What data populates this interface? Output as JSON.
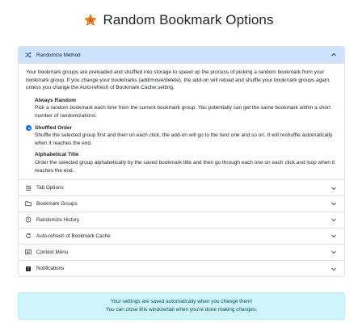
{
  "header": {
    "title": "Random Bookmark Options",
    "logo_icon": "star-icon"
  },
  "accordion": {
    "randomize_method": {
      "label": "Randomize Method",
      "icon": "shuffle-icon",
      "expanded": true,
      "intro": "Your bookmark groups are preloaded and shuffled into storage to speed up the process of picking a random bookmark from your bookmark group. If you change your bookmarks (add/move/delete), the add-on will reload and shuffle your bookmark groups again, unless you change the Auto-refresh of Bookmark Cache setting.",
      "options": [
        {
          "title": "Always Random",
          "desc": "Pick a random bookmark each time from the current bookmark group. You potentially can get the same bookmark within a short number of randomizations.",
          "selected": false
        },
        {
          "title": "Shuffled Order",
          "desc": "Shuffle the selected group first and then on each click, the add-on will go to the next one and so on. It will reshuffle automatically when it reaches the end.",
          "selected": true
        },
        {
          "title": "Alphabetical Title",
          "desc": "Order the selected group alphabetically by the saved bookmark title and then go through each one on each click and loop when it reaches the end.",
          "selected": false
        }
      ]
    },
    "sections": [
      {
        "label": "Tab Options",
        "icon": "tab-icon"
      },
      {
        "label": "Bookmark Groups",
        "icon": "folder-icon"
      },
      {
        "label": "Randomize History",
        "icon": "history-icon"
      },
      {
        "label": "Auto-refresh of Bookmark Cache",
        "icon": "refresh-icon"
      },
      {
        "label": "Context Menu",
        "icon": "menu-icon"
      },
      {
        "label": "Notifications",
        "icon": "notification-icon"
      }
    ]
  },
  "notice": {
    "line1": "Your settings are saved automatically when you change them!",
    "line2": "You can close this window/tab when you're done making changes."
  },
  "colors": {
    "accent": "#0d6efd",
    "open_header_bg": "#cfe2ff",
    "notice_bg": "#cff4fc",
    "notice_text": "#055160"
  }
}
